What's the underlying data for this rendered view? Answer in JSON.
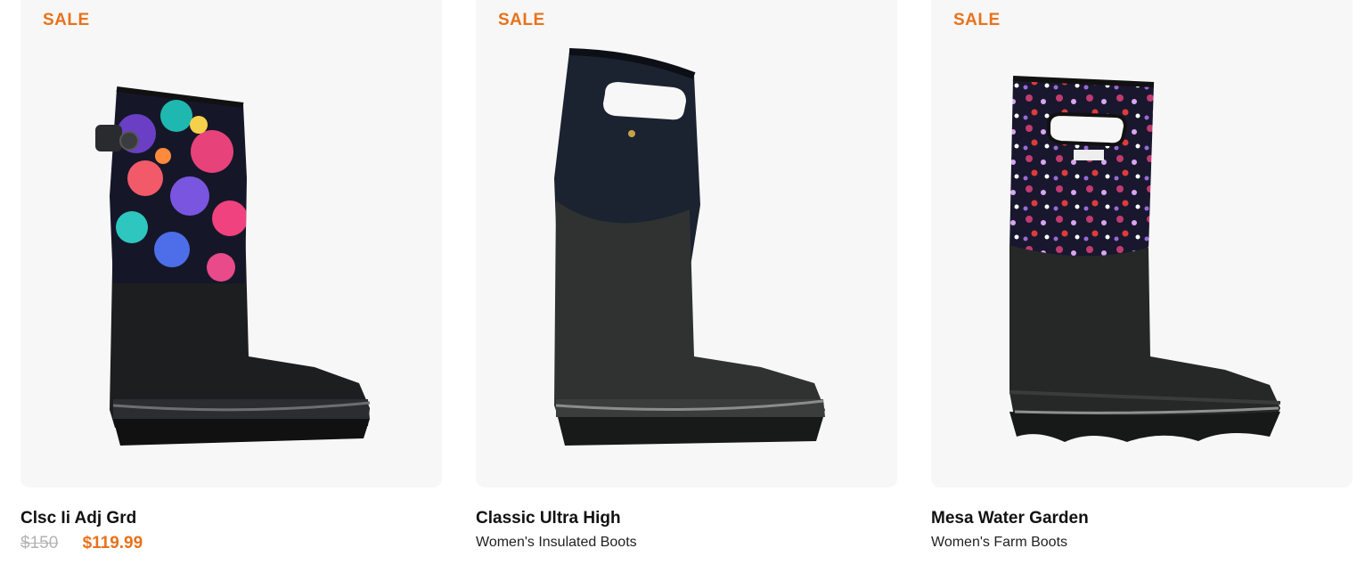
{
  "colors": {
    "sale": "#e8721b",
    "card_bg": "#f7f7f7"
  },
  "products": [
    {
      "badge": "SALE",
      "image_icon": "floral-rain-boot-image",
      "name": "Clsc Ii Adj Grd",
      "price_original": "$150",
      "price_sale": "$119.99"
    },
    {
      "badge": "SALE",
      "image_icon": "black-rain-boot-image",
      "name": "Classic Ultra High",
      "category": "Women's Insulated Boots"
    },
    {
      "badge": "SALE",
      "image_icon": "garden-rain-boot-image",
      "name": "Mesa Water Garden",
      "category": "Women's Farm Boots"
    }
  ]
}
